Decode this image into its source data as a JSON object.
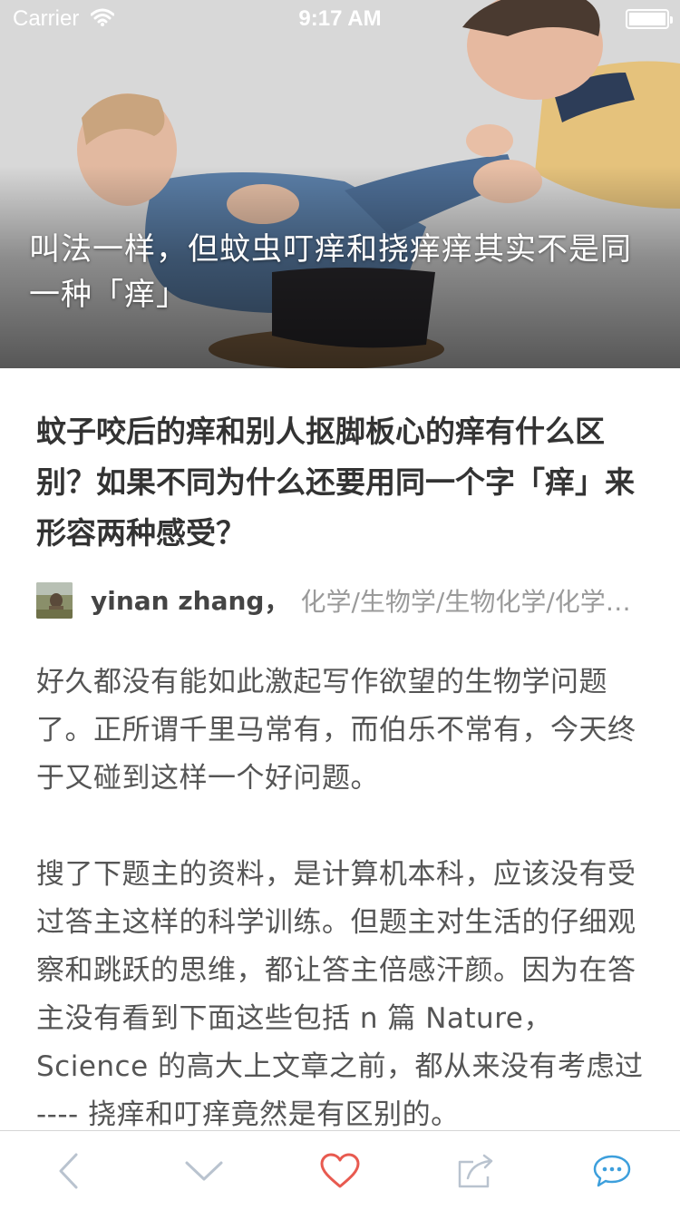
{
  "status_bar": {
    "carrier": "Carrier",
    "time": "9:17 AM",
    "wifi_icon": "wifi-icon",
    "battery_icon": "battery-icon"
  },
  "hero": {
    "caption": "叫法一样，但蚊虫叮痒和挠痒痒其实不是同一种「痒」",
    "image": "photo-adult-tickling-child-feet"
  },
  "question": {
    "title": "蚊子咬后的痒和别人抠脚板心的痒有什么区别？如果不同为什么还要用同一个字「痒」来形容两种感受？"
  },
  "author": {
    "name": "yinan zhang",
    "separator": "，",
    "bio": "化学/生物学/生物化学/化学生物学"
  },
  "answer": {
    "paragraphs": [
      "好久都没有能如此激起写作欲望的生物学问题了。正所谓千里马常有，而伯乐不常有，今天终于又碰到这样一个好问题。",
      "搜了下题主的资料，是计算机本科，应该没有受过答主这样的科学训练。但题主对生活的仔细观察和跳跃的思维，都让答主倍感汗颜。因为在答主没有看到下面这些包括 n 篇 Nature，Science 的高大上文章之前，都从来没有考虑过 ---- 挠痒和叮痒竟然是有区别的。"
    ]
  },
  "toolbar": {
    "items": [
      {
        "name": "back",
        "icon": "chevron-left-icon"
      },
      {
        "name": "next",
        "icon": "chevron-down-icon"
      },
      {
        "name": "like",
        "icon": "heart-icon"
      },
      {
        "name": "share",
        "icon": "share-icon"
      },
      {
        "name": "comment",
        "icon": "comment-icon"
      }
    ]
  },
  "colors": {
    "accent_blue": "#3d9fdc",
    "like_red": "#e85a50",
    "icon_gray": "#b9c3cf",
    "title_text": "#333333",
    "body_text": "#555555",
    "meta_text": "#9a9a9a"
  }
}
